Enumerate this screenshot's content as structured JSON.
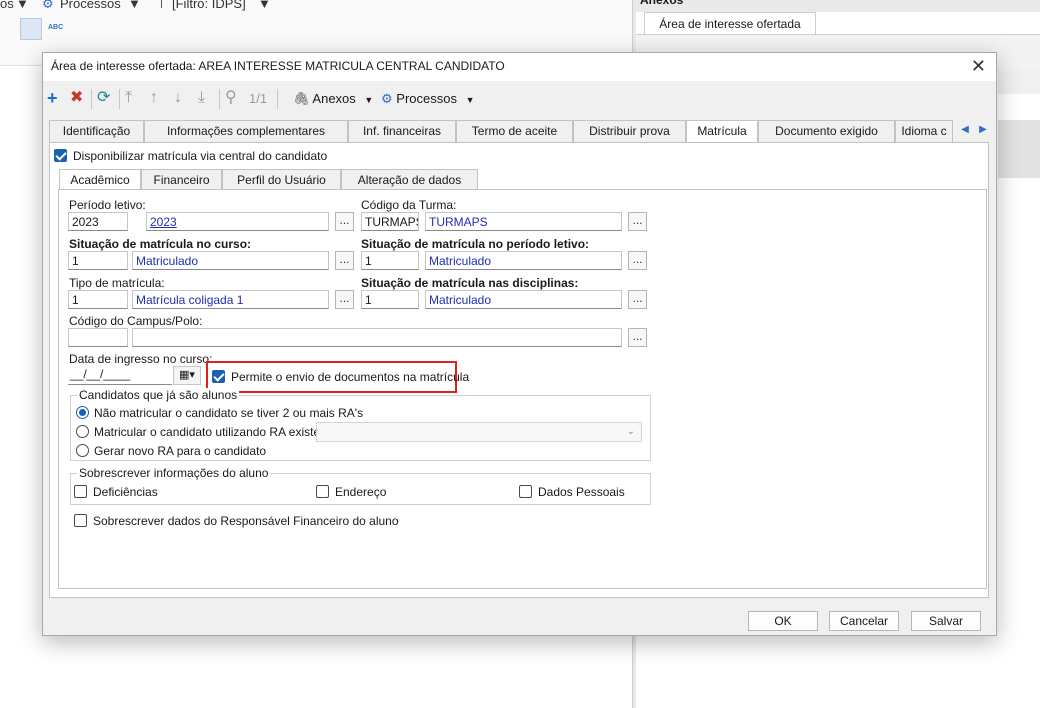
{
  "background": {
    "top_items": [
      "os",
      "Processos",
      "[Filtro: IDPS]"
    ],
    "right_header": "Anexos",
    "right_tab": "Área de interesse ofertada"
  },
  "dialog": {
    "title": "Área de interesse ofertada: AREA INTERESSE MATRICULA CENTRAL CANDIDATO",
    "toolbar": {
      "record_counter": "1/1",
      "anexos": "Anexos",
      "processos": "Processos"
    },
    "tabs": [
      "Identificação",
      "Informações complementares",
      "Inf. financeiras",
      "Termo de aceite",
      "Distribuir prova",
      "Matrícula",
      "Documento exigido",
      "Idioma c"
    ],
    "active_tab": "Matrícula",
    "central_checkbox": "Disponibilizar matrícula via central do candidato",
    "inner_tabs": [
      "Acadêmico",
      "Financeiro",
      "Perfil do Usuário",
      "Alteração de dados"
    ],
    "active_inner_tab": "Acadêmico",
    "form": {
      "periodo_letivo": {
        "label": "Período letivo:",
        "code": "2023",
        "desc": "2023"
      },
      "codigo_turma": {
        "label": "Código da Turma:",
        "code": "TURMAPS",
        "desc": "TURMAPS"
      },
      "sit_curso": {
        "label": "Situação de matrícula no curso:",
        "code": "1",
        "desc": "Matriculado"
      },
      "sit_periodo": {
        "label": "Situação de matrícula no período letivo:",
        "code": "1",
        "desc": "Matriculado"
      },
      "tipo_matricula": {
        "label": "Tipo de matrícula:",
        "code": "1",
        "desc": "Matrícula coligada 1"
      },
      "sit_disciplinas": {
        "label": "Situação de matrícula nas disciplinas:",
        "code": "1",
        "desc": "Matriculado"
      },
      "campus": {
        "label": "Código do Campus/Polo:",
        "code": "",
        "desc": ""
      },
      "data_ingresso": {
        "label": "Data de ingresso no curso:",
        "mask": "__/__/____"
      },
      "permite_envio": "Permite o envio de documentos na matrícula",
      "candidatos_group": {
        "title": "Candidatos que já são alunos",
        "options": [
          "Não matricular o candidato se tiver 2 ou mais RA's",
          "Matricular o candidato utilizando RA existente",
          "Gerar novo RA para o candidato"
        ],
        "ra_select": ""
      },
      "sobrescrever_group": {
        "title": "Sobrescrever informações do aluno",
        "options": [
          "Deficiências",
          "Endereço",
          "Dados Pessoais"
        ]
      },
      "sobrescrever_responsavel": "Sobrescrever dados do Responsável Financeiro do aluno"
    },
    "buttons": {
      "ok": "OK",
      "cancelar": "Cancelar",
      "salvar": "Salvar"
    }
  }
}
